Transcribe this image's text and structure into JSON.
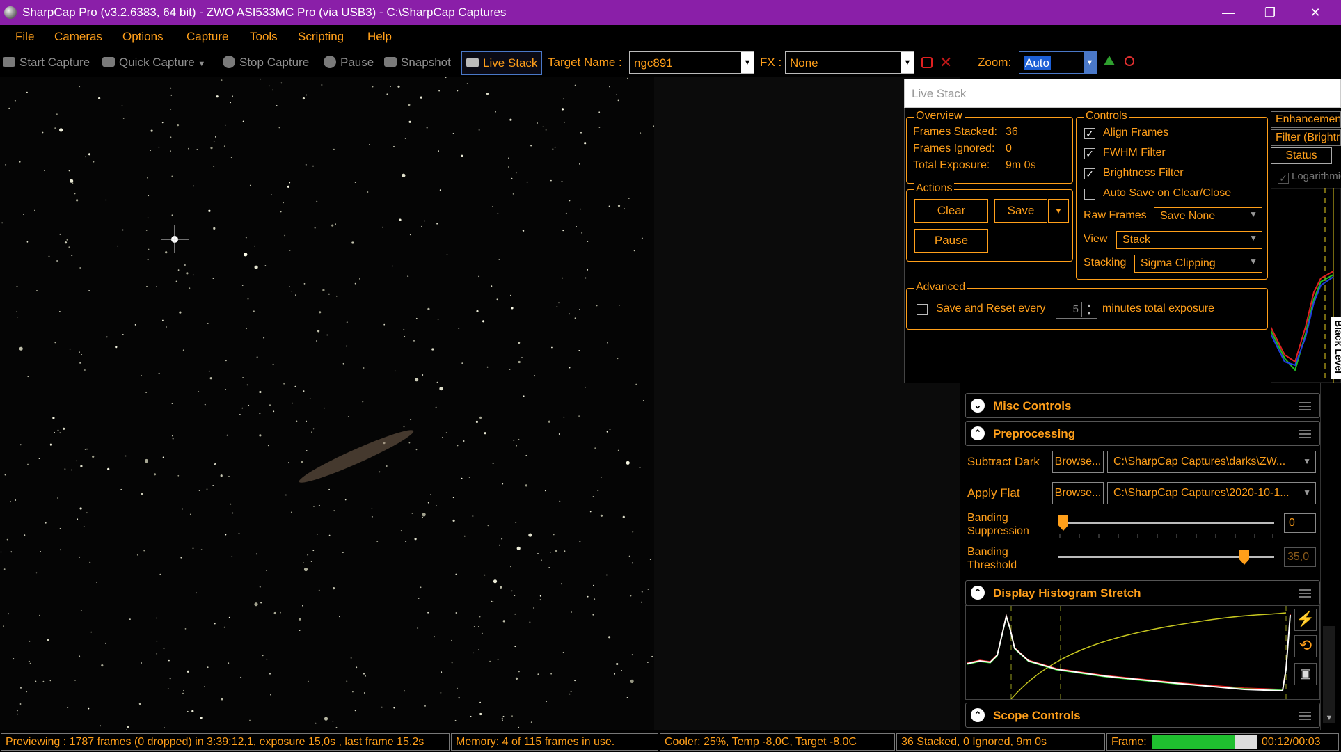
{
  "window": {
    "title": "SharpCap Pro (v3.2.6383, 64 bit) - ZWO ASI533MC Pro (via USB3) - C:\\SharpCap Captures",
    "minimize": "—",
    "maximize": "❐",
    "close": "✕"
  },
  "menu": [
    "File",
    "Cameras",
    "Options",
    "Capture",
    "Tools",
    "Scripting",
    "Help"
  ],
  "toolbar": {
    "start_capture": "Start Capture",
    "quick_capture": "Quick Capture",
    "stop_capture": "Stop Capture",
    "pause": "Pause",
    "snapshot": "Snapshot",
    "live_stack": "Live Stack",
    "target_name_label": "Target Name :",
    "target_name_value": "ngc891",
    "fx_label": "FX :",
    "fx_value": "None",
    "zoom_label": "Zoom:",
    "zoom_value": "Auto"
  },
  "live_stack": {
    "header": "Live Stack",
    "overview": {
      "title": "Overview",
      "frames_stacked_label": "Frames Stacked:",
      "frames_stacked": "36",
      "frames_ignored_label": "Frames Ignored:",
      "frames_ignored": "0",
      "total_exposure_label": "Total Exposure:",
      "total_exposure": "9m 0s"
    },
    "actions": {
      "title": "Actions",
      "clear": "Clear",
      "save": "Save",
      "pause": "Pause"
    },
    "controls": {
      "title": "Controls",
      "align_frames": "Align Frames",
      "fwhm_filter": "FWHM Filter",
      "brightness_filter": "Brightness Filter",
      "auto_save": "Auto Save on Clear/Close",
      "raw_frames_label": "Raw Frames",
      "raw_frames_value": "Save None",
      "view_label": "View",
      "view_value": "Stack",
      "stacking_label": "Stacking",
      "stacking_value": "Sigma Clipping"
    },
    "advanced": {
      "title": "Advanced",
      "save_reset_label": "Save and Reset every",
      "minutes_value": "5",
      "minutes_suffix": "minutes total exposure"
    },
    "side_tabs": [
      "Enhancement",
      "Filter (Brightness)",
      "Status"
    ],
    "logarithmic_label": "Logarithmic",
    "black_level_label": "Black Level"
  },
  "panels": {
    "misc_controls": "Misc Controls",
    "preprocessing": {
      "title": "Preprocessing",
      "subtract_dark_label": "Subtract Dark",
      "subtract_dark_browse": "Browse...",
      "subtract_dark_path": "C:\\SharpCap Captures\\darks\\ZW...",
      "apply_flat_label": "Apply Flat",
      "apply_flat_browse": "Browse...",
      "apply_flat_path": "C:\\SharpCap Captures\\2020-10-1...",
      "banding_suppression_label_1": "Banding",
      "banding_suppression_label_2": "Suppression",
      "banding_suppression_value": "0",
      "banding_suppression_level": 0,
      "banding_threshold_label_1": "Banding",
      "banding_threshold_label_2": "Threshold",
      "banding_threshold_value": "35,0",
      "banding_threshold_level": 0.88
    },
    "display_histogram_stretch": "Display Histogram Stretch",
    "scope_controls": "Scope Controls"
  },
  "statusbar": {
    "previewing": "Previewing : 1787 frames (0 dropped) in 3:39:12,1, exposure 15,0s , last frame 15,2s",
    "memory": "Memory: 4 of 115 frames in use.",
    "cooler": "Cooler: 25%, Temp -8,0C, Target -8,0C",
    "stack": "36 Stacked, 0 Ignored, 9m 0s",
    "frame_label": "Frame:",
    "frame_progress": 0.78,
    "frame_time": "00:12/00:03"
  },
  "colors": {
    "accent": "#ff9f1a",
    "titlebar": "#8a1fa8",
    "progress": "#1fbf2f"
  }
}
